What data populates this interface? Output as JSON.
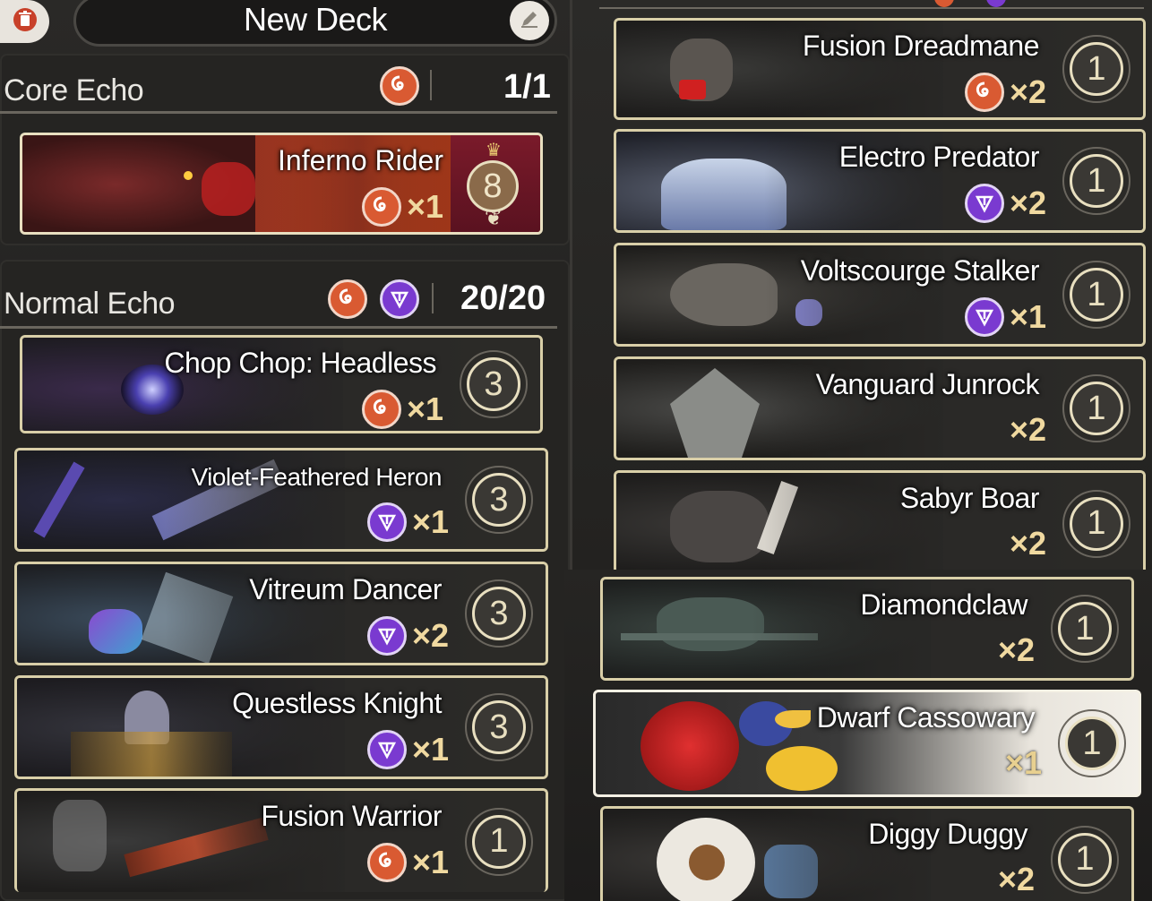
{
  "header": {
    "deck_name": "New Deck"
  },
  "core_echo": {
    "title": "Core Echo",
    "count": "1/1",
    "card": {
      "name": "Inferno Rider",
      "element": "fusion",
      "multiplier": "×1",
      "cost": "8"
    }
  },
  "normal_echo": {
    "title": "Normal Echo",
    "count": "20/20",
    "cards": [
      {
        "name": "Chop Chop: Headless",
        "element": "fusion",
        "multiplier": "×1",
        "cost": "3"
      },
      {
        "name": "Violet-Feathered Heron",
        "element": "electro",
        "multiplier": "×1",
        "cost": "3"
      },
      {
        "name": "Vitreum Dancer",
        "element": "electro",
        "multiplier": "×2",
        "cost": "3"
      },
      {
        "name": "Questless Knight",
        "element": "electro",
        "multiplier": "×1",
        "cost": "3"
      },
      {
        "name": "Fusion Warrior",
        "element": "fusion",
        "multiplier": "×1",
        "cost": "1"
      }
    ]
  },
  "right_column_top": {
    "cards": [
      {
        "name": "Fusion Dreadmane",
        "element": "fusion",
        "multiplier": "×2",
        "cost": "1"
      },
      {
        "name": "Electro Predator",
        "element": "electro",
        "multiplier": "×2",
        "cost": "1"
      },
      {
        "name": "Voltscourge Stalker",
        "element": "electro",
        "multiplier": "×1",
        "cost": "1"
      },
      {
        "name": "Vanguard Junrock",
        "element": "none",
        "multiplier": "×2",
        "cost": "1"
      },
      {
        "name": "Sabyr Boar",
        "element": "none",
        "multiplier": "×2",
        "cost": "1"
      }
    ]
  },
  "right_column_bottom": {
    "cards": [
      {
        "name": "Diamondclaw",
        "element": "none",
        "multiplier": "×2",
        "cost": "1"
      },
      {
        "name": "Dwarf Cassowary",
        "element": "none",
        "multiplier": "×1",
        "cost": "1"
      },
      {
        "name": "Diggy Duggy",
        "element": "none",
        "multiplier": "×2",
        "cost": "1"
      }
    ]
  },
  "icons": {
    "delete": "trash-icon",
    "edit": "pencil-icon",
    "fusion": "fusion-element-icon",
    "electro": "electro-element-icon"
  },
  "colors": {
    "fusion": "#d95a32",
    "electro": "#7a3ad0",
    "card_border": "#d9cfa8",
    "multiplier": "#f0d9a0"
  }
}
